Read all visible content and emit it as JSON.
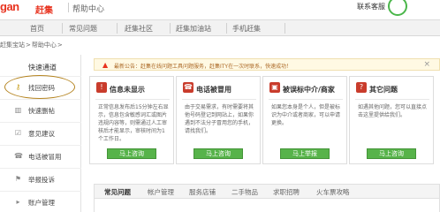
{
  "header": {
    "logo": "gan",
    "brand": "赶集",
    "section": "帮助中心",
    "support_label": "联系客服"
  },
  "nav": {
    "items": [
      "首页",
      "常见问题",
      "赶集社区",
      "赶集加油站",
      "手机赶集"
    ]
  },
  "breadcrumb": {
    "items": [
      "赶集宝站",
      ">",
      "帮助中心",
      ">"
    ]
  },
  "sidebar": {
    "title": "快速通道",
    "items": [
      {
        "label": "找回密码",
        "icon": "key-icon"
      },
      {
        "label": "快速删帖",
        "icon": "trash-icon"
      },
      {
        "label": "意见建议",
        "icon": "checkbox-icon"
      },
      {
        "label": "电话被冒用",
        "icon": "phone-icon"
      },
      {
        "label": "举报投诉",
        "icon": "flag-icon"
      },
      {
        "label": "账户管理",
        "icon": "user-icon"
      }
    ]
  },
  "notice": {
    "text": "最新公告：赶集在线问题工具问题服务，赶集ITY在一次时联系，快速成功！"
  },
  "cards": [
    {
      "title": "信息未显示",
      "desc": "正常信息发布后15分钟左右显示，信息包含敏感词汇或图片违规内容等，则需通过人工审核后才能显示，审核时间为1个工作日。",
      "button": "马上咨询"
    },
    {
      "title": "电话被冒用",
      "desc": "由于交易需求，有时需要将其他号码登记到网站上，如果你遇到不法分子冒用您的手机，请找我们。",
      "button": "马上咨询"
    },
    {
      "title": "被误标中介/商家",
      "desc": "如果您本身是个人，但是被标识为中介或者商家，可以申请更换。",
      "button": "马上举报"
    },
    {
      "title": "其它问题",
      "desc": "如遇其他问题，您可以直接点击这里提供给我们。",
      "button": "马上咨询"
    }
  ],
  "tabs": {
    "items": [
      "常见问题",
      "帐户管理",
      "服务店铺",
      "二手物品",
      "求职招聘",
      "火车票攻略"
    ]
  }
}
